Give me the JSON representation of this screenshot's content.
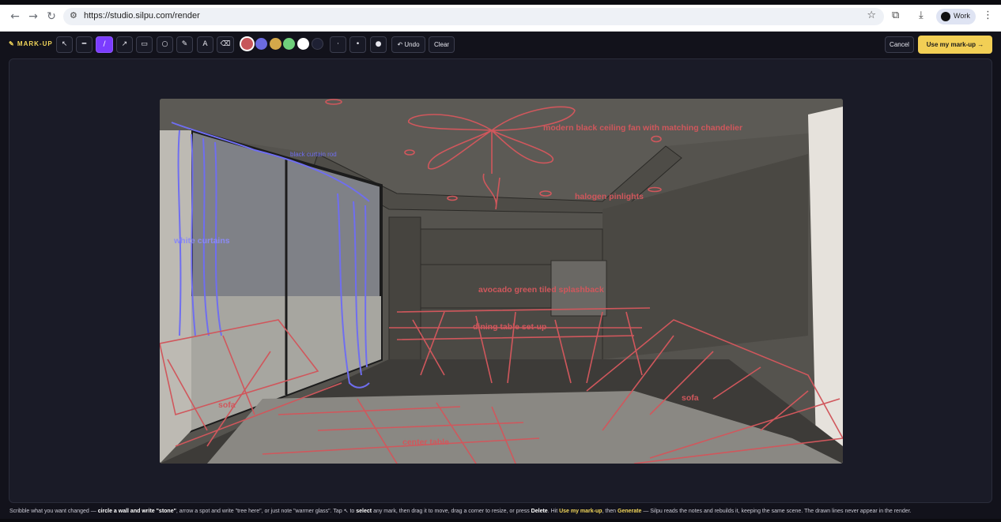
{
  "browser": {
    "url": "https://studio.silpu.com/render",
    "profile_label": "Work",
    "icons": [
      "back-icon",
      "forward-icon",
      "reload-icon",
      "site-settings-icon",
      "bookmark-star-icon",
      "extensions-icon",
      "download-icon",
      "menu-kebab-icon"
    ]
  },
  "toolbar": {
    "brand": "✎ MARK-UP",
    "tools": [
      {
        "name": "select-tool",
        "glyph": "↖"
      },
      {
        "name": "line-tool",
        "glyph": "━"
      },
      {
        "name": "pen-tool",
        "glyph": "/",
        "active": true
      },
      {
        "name": "arrow-tool",
        "glyph": "↗"
      },
      {
        "name": "rect-tool",
        "glyph": "▭"
      },
      {
        "name": "ellipse-tool",
        "glyph": "○"
      },
      {
        "name": "brush-tool",
        "glyph": "✎"
      },
      {
        "name": "text-tool",
        "glyph": "A"
      },
      {
        "name": "eraser-tool",
        "glyph": "⌫"
      }
    ],
    "colors": [
      "#c7565a",
      "#6b6be0",
      "#d4a84a",
      "#6fcf7b",
      "#ffffff",
      "#1e2033"
    ],
    "selected_color": "#c7565a",
    "sizes": [
      "·",
      "•",
      "●"
    ],
    "undo_label": "↶ Undo",
    "clear_label": "Clear",
    "cancel_label": "Cancel",
    "use_label": "Use my mark-up →"
  },
  "annotations": {
    "ceiling_fan": "modern black ceiling fan with matching chandelier",
    "pinlights": "halogen pinlights",
    "curtain_rod": "black curtain rod",
    "curtains": "white curtains",
    "splashback": "avocado green tiled splashback",
    "dining": "dining table set-up",
    "sofa_left": "sofa",
    "sofa_right": "sofa",
    "center_table": "center table"
  },
  "footer": {
    "p1": "Scribble what you want changed — ",
    "b1": "circle a wall and write \"stone\"",
    "p2": ", arrow a spot and write \"tree here\", or just note \"warmer glass\". Tap ↖ to ",
    "b2": "select",
    "p3": " any mark, then drag it to move, drag a corner to resize, or press ",
    "b3": "Delete",
    "p4": ". Hit ",
    "b4": "Use my mark-up",
    "p5": ", then ",
    "b5": "Generate",
    "p6": " — Silpu reads the notes and rebuilds it, keeping the same scene. The drawn lines never appear in the render."
  }
}
